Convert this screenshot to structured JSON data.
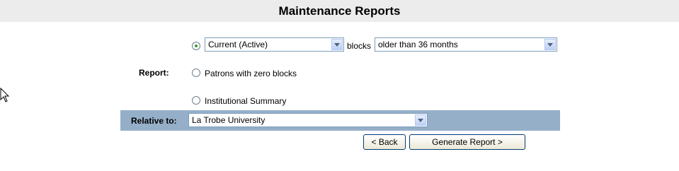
{
  "title": "Maintenance Reports",
  "report": {
    "label": "Report:",
    "option_current_value": "Current (Active)",
    "blocks_text": "blocks",
    "age_value": "older than 36 months",
    "option_zero_blocks": "Patrons with zero blocks",
    "option_institutional": "Institutional Summary",
    "selected": "current"
  },
  "relative": {
    "label": "Relative to:",
    "value": "La Trobe University"
  },
  "buttons": {
    "back": "< Back",
    "generate": "Generate Report >"
  },
  "colors": {
    "title_bar": "#ececec",
    "relative_band": "#95afc9",
    "radio_selected": "#2f9e2f"
  }
}
